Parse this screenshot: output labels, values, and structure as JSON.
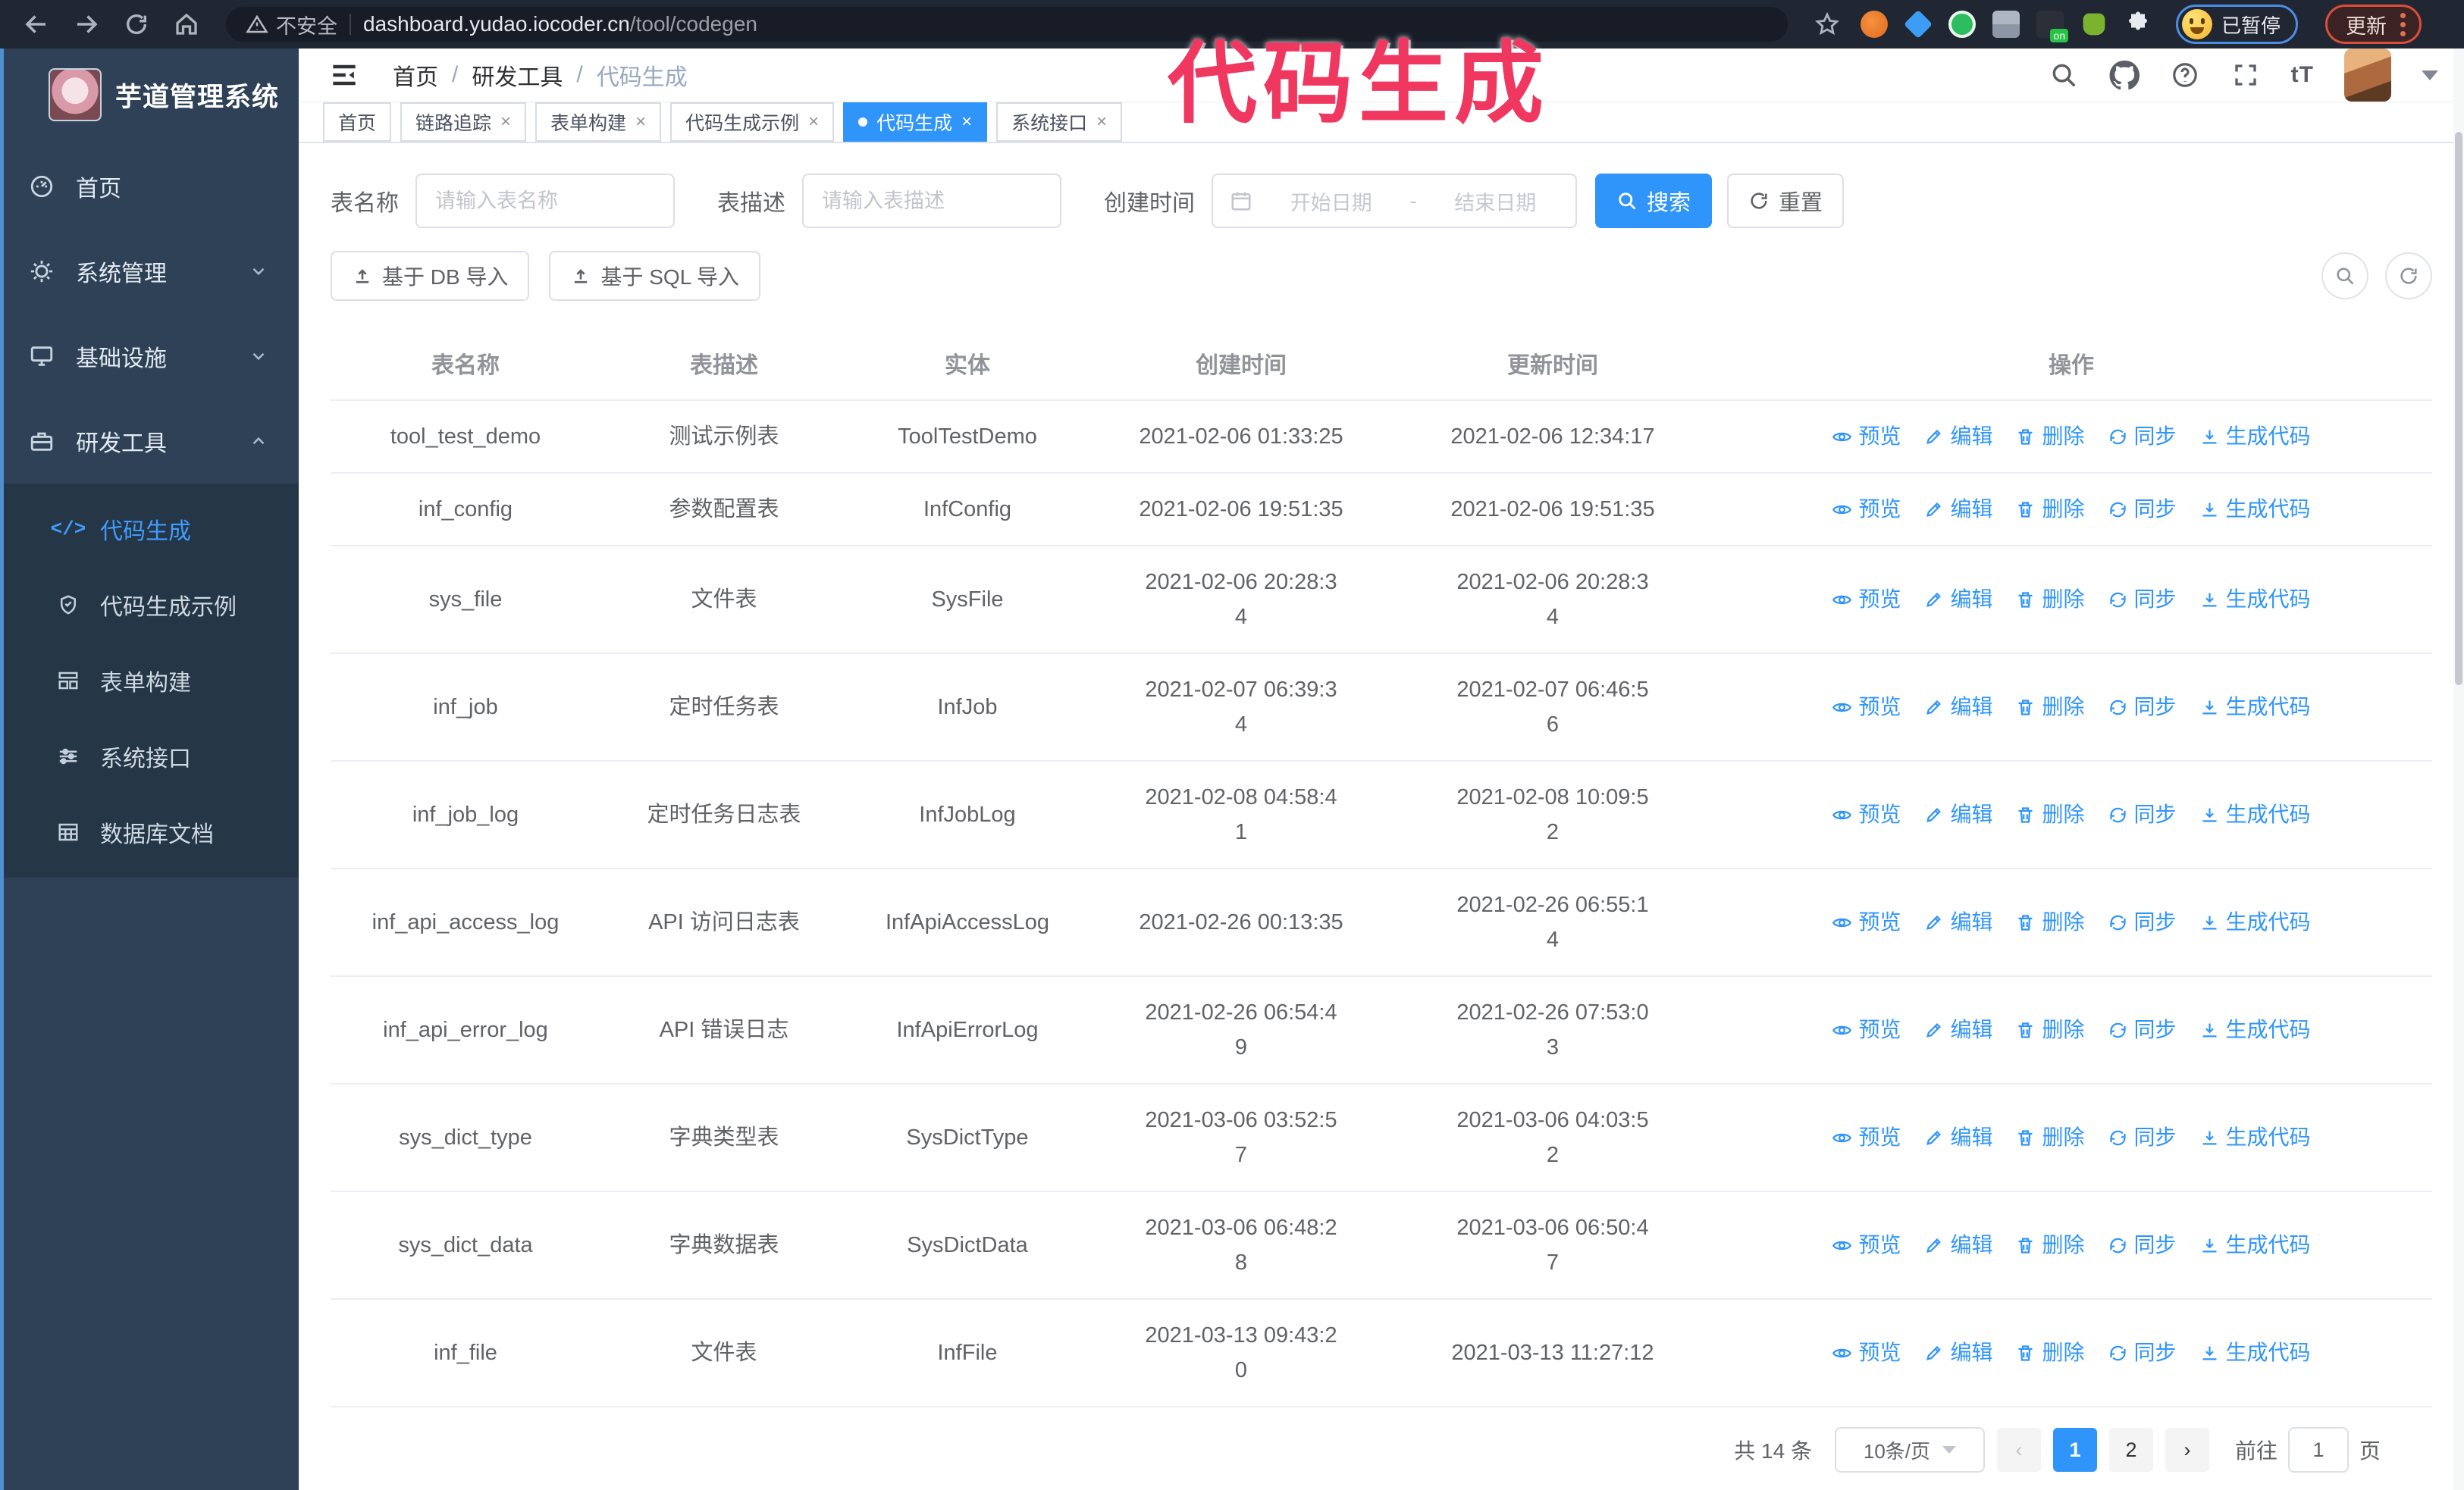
{
  "browser": {
    "security_label": "不安全",
    "url_host": "dashboard.yudao.iocoder.cn",
    "url_path": "/tool/codegen",
    "profile_badge": "已暂停",
    "update_label": "更新"
  },
  "annotation": {
    "text": "代码生成",
    "color": "#f0375f"
  },
  "sidebar": {
    "title": "芋道管理系统",
    "menu": [
      {
        "label": "首页"
      },
      {
        "label": "系统管理",
        "state": "collapsed"
      },
      {
        "label": "基础设施",
        "state": "collapsed"
      },
      {
        "label": "研发工具",
        "state": "expanded"
      }
    ],
    "submenu": [
      {
        "label": "代码生成",
        "active": true
      },
      {
        "label": "代码生成示例",
        "active": false
      },
      {
        "label": "表单构建",
        "active": false
      },
      {
        "label": "系统接口",
        "active": false
      },
      {
        "label": "数据库文档",
        "active": false
      }
    ]
  },
  "header": {
    "breadcrumb": [
      "首页",
      "研发工具",
      "代码生成"
    ],
    "separator": "/"
  },
  "tabs": [
    {
      "label": "首页",
      "closable": false,
      "active": false
    },
    {
      "label": "链路追踪",
      "closable": true,
      "active": false
    },
    {
      "label": "表单构建",
      "closable": true,
      "active": false
    },
    {
      "label": "代码生成示例",
      "closable": true,
      "active": false
    },
    {
      "label": "代码生成",
      "closable": true,
      "active": true
    },
    {
      "label": "系统接口",
      "closable": true,
      "active": false
    }
  ],
  "search": {
    "name_label": "表名称",
    "name_placeholder": "请输入表名称",
    "desc_label": "表描述",
    "desc_placeholder": "请输入表描述",
    "time_label": "创建时间",
    "start_placeholder": "开始日期",
    "range_separator": "-",
    "end_placeholder": "结束日期",
    "search_label": "搜索",
    "reset_label": "重置"
  },
  "toolbar": {
    "import_db": "基于 DB 导入",
    "import_sql": "基于 SQL 导入"
  },
  "table": {
    "columns": [
      "表名称",
      "表描述",
      "实体",
      "创建时间",
      "更新时间",
      "操作"
    ],
    "actions": [
      "预览",
      "编辑",
      "删除",
      "同步",
      "生成代码"
    ],
    "rows": [
      {
        "name": "tool_test_demo",
        "desc": "测试示例表",
        "entity": "ToolTestDemo",
        "created": "2021-02-06 01:33:25",
        "updated": "2021-02-06 12:34:17"
      },
      {
        "name": "inf_config",
        "desc": "参数配置表",
        "entity": "InfConfig",
        "created": "2021-02-06 19:51:35",
        "updated": "2021-02-06 19:51:35"
      },
      {
        "name": "sys_file",
        "desc": "文件表",
        "entity": "SysFile",
        "created": "2021-02-06 20:28:3\n4",
        "updated": "2021-02-06 20:28:3\n4"
      },
      {
        "name": "inf_job",
        "desc": "定时任务表",
        "entity": "InfJob",
        "created": "2021-02-07 06:39:3\n4",
        "updated": "2021-02-07 06:46:5\n6"
      },
      {
        "name": "inf_job_log",
        "desc": "定时任务日志表",
        "entity": "InfJobLog",
        "created": "2021-02-08 04:58:4\n1",
        "updated": "2021-02-08 10:09:5\n2"
      },
      {
        "name": "inf_api_access_log",
        "desc": "API 访问日志表",
        "entity": "InfApiAccessLog",
        "created": "2021-02-26 00:13:35",
        "updated": "2021-02-26 06:55:1\n4"
      },
      {
        "name": "inf_api_error_log",
        "desc": "API 错误日志",
        "entity": "InfApiErrorLog",
        "created": "2021-02-26 06:54:4\n9",
        "updated": "2021-02-26 07:53:0\n3"
      },
      {
        "name": "sys_dict_type",
        "desc": "字典类型表",
        "entity": "SysDictType",
        "created": "2021-03-06 03:52:5\n7",
        "updated": "2021-03-06 04:03:5\n2"
      },
      {
        "name": "sys_dict_data",
        "desc": "字典数据表",
        "entity": "SysDictData",
        "created": "2021-03-06 06:48:2\n8",
        "updated": "2021-03-06 06:50:4\n7"
      },
      {
        "name": "inf_file",
        "desc": "文件表",
        "entity": "InfFile",
        "created": "2021-03-13 09:43:2\n0",
        "updated": "2021-03-13 11:27:12"
      }
    ]
  },
  "pagination": {
    "total": "共 14 条",
    "page_size": "10条/页",
    "pages": [
      "1",
      "2"
    ],
    "active_page": "1",
    "goto_label": "前往",
    "goto_value": "1",
    "goto_suffix": "页"
  },
  "colors": {
    "accent_blue": "#2f95fb",
    "sidebar_bg": "#2e4156",
    "submenu_bg": "#253646",
    "browser_bar": "#202632",
    "annotation_pink": "#f0375f"
  }
}
